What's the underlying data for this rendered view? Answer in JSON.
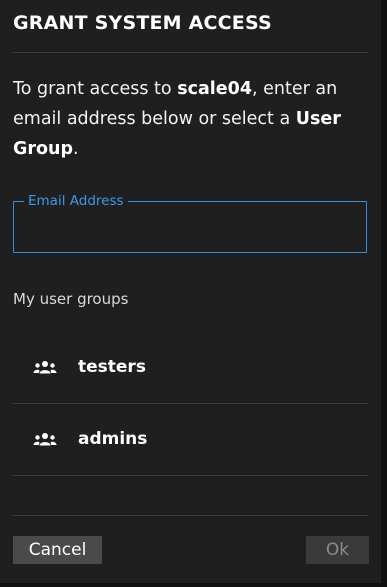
{
  "dialog": {
    "title": "GRANT SYSTEM ACCESS",
    "intro": {
      "prefix": "To grant access to ",
      "system_name": "scale04",
      "middle": ", enter an email address below or select a ",
      "emphasis": "User Group",
      "suffix": "."
    },
    "email_field": {
      "label": "Email Address",
      "value": "",
      "placeholder": ""
    },
    "groups_heading": "My user groups",
    "groups": [
      {
        "name": "testers",
        "icon": "group-icon"
      },
      {
        "name": "admins",
        "icon": "group-icon"
      }
    ],
    "buttons": {
      "cancel": "Cancel",
      "ok": "Ok",
      "ok_disabled": true
    }
  },
  "colors": {
    "background": "#1f1f1f",
    "accent": "#2f8fe0",
    "divider": "#3a3a3a"
  }
}
